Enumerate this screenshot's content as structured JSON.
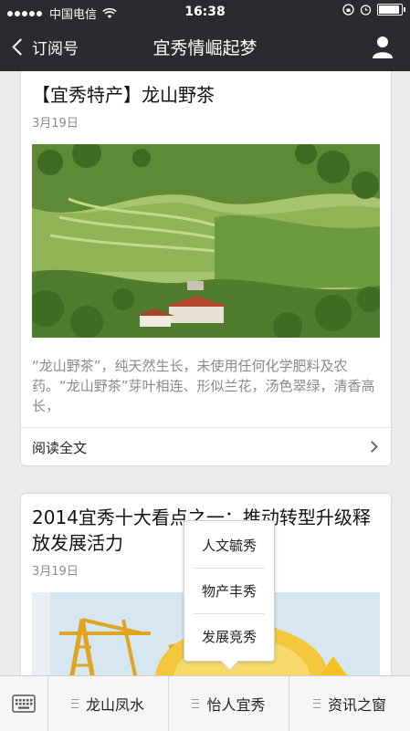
{
  "status_bar": {
    "carrier": "中国电信",
    "time": "16:38",
    "battery_level": 0.9
  },
  "nav": {
    "back_label": "订阅号",
    "title": "宜秀情崛起梦",
    "profile_icon": "person-icon"
  },
  "articles": [
    {
      "title": "【宜秀特产】龙山野茶",
      "date": "3月19日",
      "image": "tea-plantation-hillside",
      "summary": "“龙山野茶”，纯天然生长，未使用任何化学肥料及农药。“龙山野茶”芽叶相连、形似兰花，汤色翠绿，清香高长，",
      "read_more": "阅读全文"
    },
    {
      "title": "2014宜秀十大看点之一：推动转型升级释放发展活力",
      "date": "3月19日",
      "image": "construction-crane-coins"
    }
  ],
  "popup_menu": {
    "items": [
      "人文毓秀",
      "物产丰秀",
      "发展竞秀"
    ]
  },
  "bottom_menu": {
    "keyboard_icon": "keyboard-icon",
    "items": [
      "龙山凤水",
      "怡人宜秀",
      "资讯之窗"
    ]
  }
}
